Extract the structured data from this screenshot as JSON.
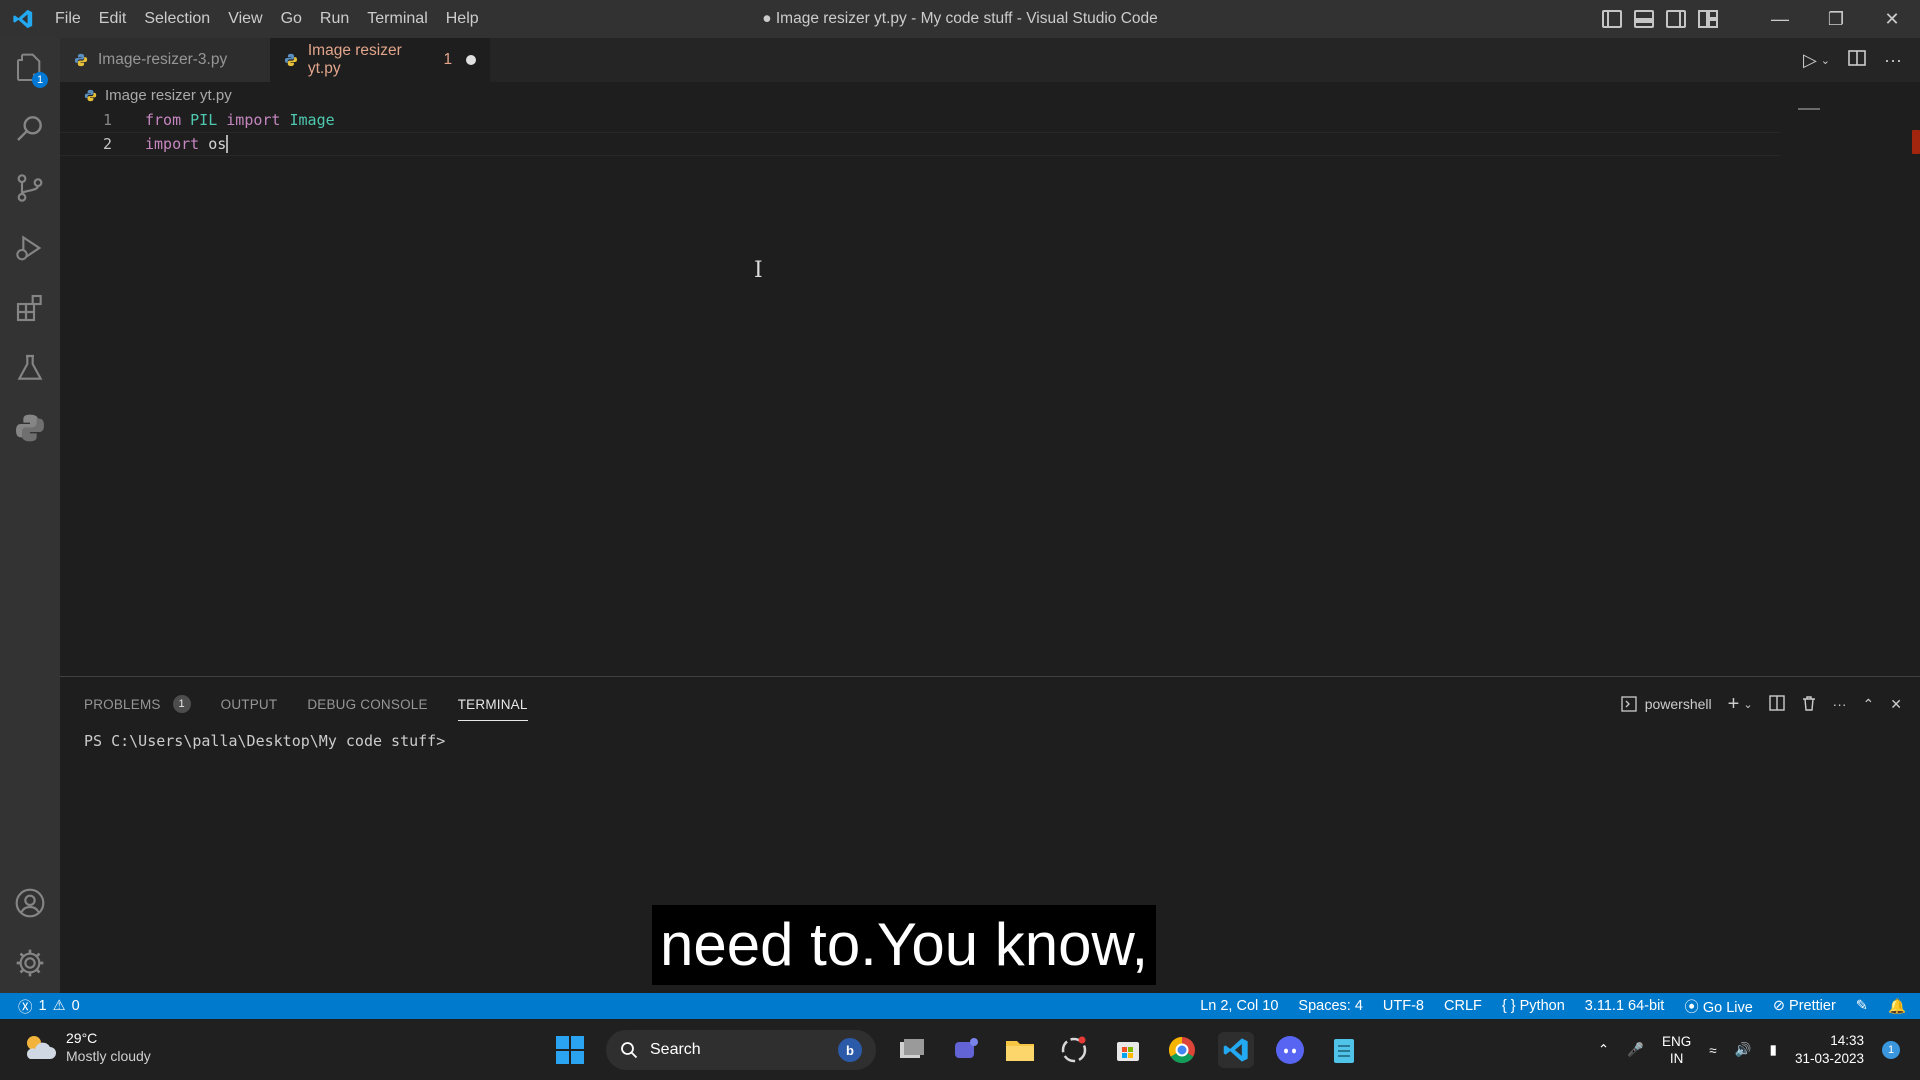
{
  "window": {
    "title": "● Image resizer yt.py - My code stuff - Visual Studio Code"
  },
  "menu": [
    "File",
    "Edit",
    "Selection",
    "View",
    "Go",
    "Run",
    "Terminal",
    "Help"
  ],
  "activity_bar": {
    "explorer_badge": "1",
    "top_icons": [
      "files-icon",
      "search-icon",
      "source-control-icon",
      "run-debug-icon",
      "extensions-icon",
      "testing-icon",
      "python-icon"
    ],
    "bottom_icons": [
      "account-icon",
      "settings-gear-icon"
    ]
  },
  "tabs": [
    {
      "label": "Image-resizer-3.py",
      "active": false
    },
    {
      "label": "Image resizer yt.py",
      "active": true,
      "problems": "1",
      "modified": true
    }
  ],
  "breadcrumb": "Image resizer yt.py",
  "editor": {
    "lines": [
      {
        "number": "1",
        "tokens": [
          {
            "t": "from",
            "c": "kw"
          },
          {
            "t": " ",
            "c": "plain"
          },
          {
            "t": "PIL",
            "c": "mod"
          },
          {
            "t": " ",
            "c": "plain"
          },
          {
            "t": "import",
            "c": "kw"
          },
          {
            "t": " ",
            "c": "plain"
          },
          {
            "t": "Image",
            "c": "mod"
          }
        ]
      },
      {
        "number": "2",
        "tokens": [
          {
            "t": "import",
            "c": "kw"
          },
          {
            "t": " ",
            "c": "plain"
          },
          {
            "t": "os",
            "c": "plain"
          }
        ]
      }
    ]
  },
  "panel": {
    "tabs": [
      {
        "label": "PROBLEMS",
        "badge": "1",
        "active": false
      },
      {
        "label": "OUTPUT",
        "active": false
      },
      {
        "label": "DEBUG CONSOLE",
        "active": false
      },
      {
        "label": "TERMINAL",
        "active": true
      }
    ],
    "shell": "powershell",
    "terminal_prompt": "PS C:\\Users\\palla\\Desktop\\My code stuff>"
  },
  "caption": "need to.You know,",
  "status_bar": {
    "errors": "1",
    "warnings": "0",
    "position": "Ln 2, Col 10",
    "spaces": "Spaces: 4",
    "encoding": "UTF-8",
    "eol": "CRLF",
    "language": "Python",
    "interpreter": "3.11.1 64-bit",
    "go_live": "Go Live",
    "prettier": "Prettier"
  },
  "taskbar": {
    "temperature": "29°C",
    "condition": "Mostly cloudy",
    "search": "Search",
    "lang_top": "ENG",
    "lang_bottom": "IN",
    "time": "14:33",
    "date": "31-03-2023",
    "notification_count": "1"
  },
  "colors": {
    "status_bar": "#007acc",
    "editor_bg": "#1e1e1e",
    "keyword": "#c586c0",
    "module": "#4ec9b0"
  }
}
